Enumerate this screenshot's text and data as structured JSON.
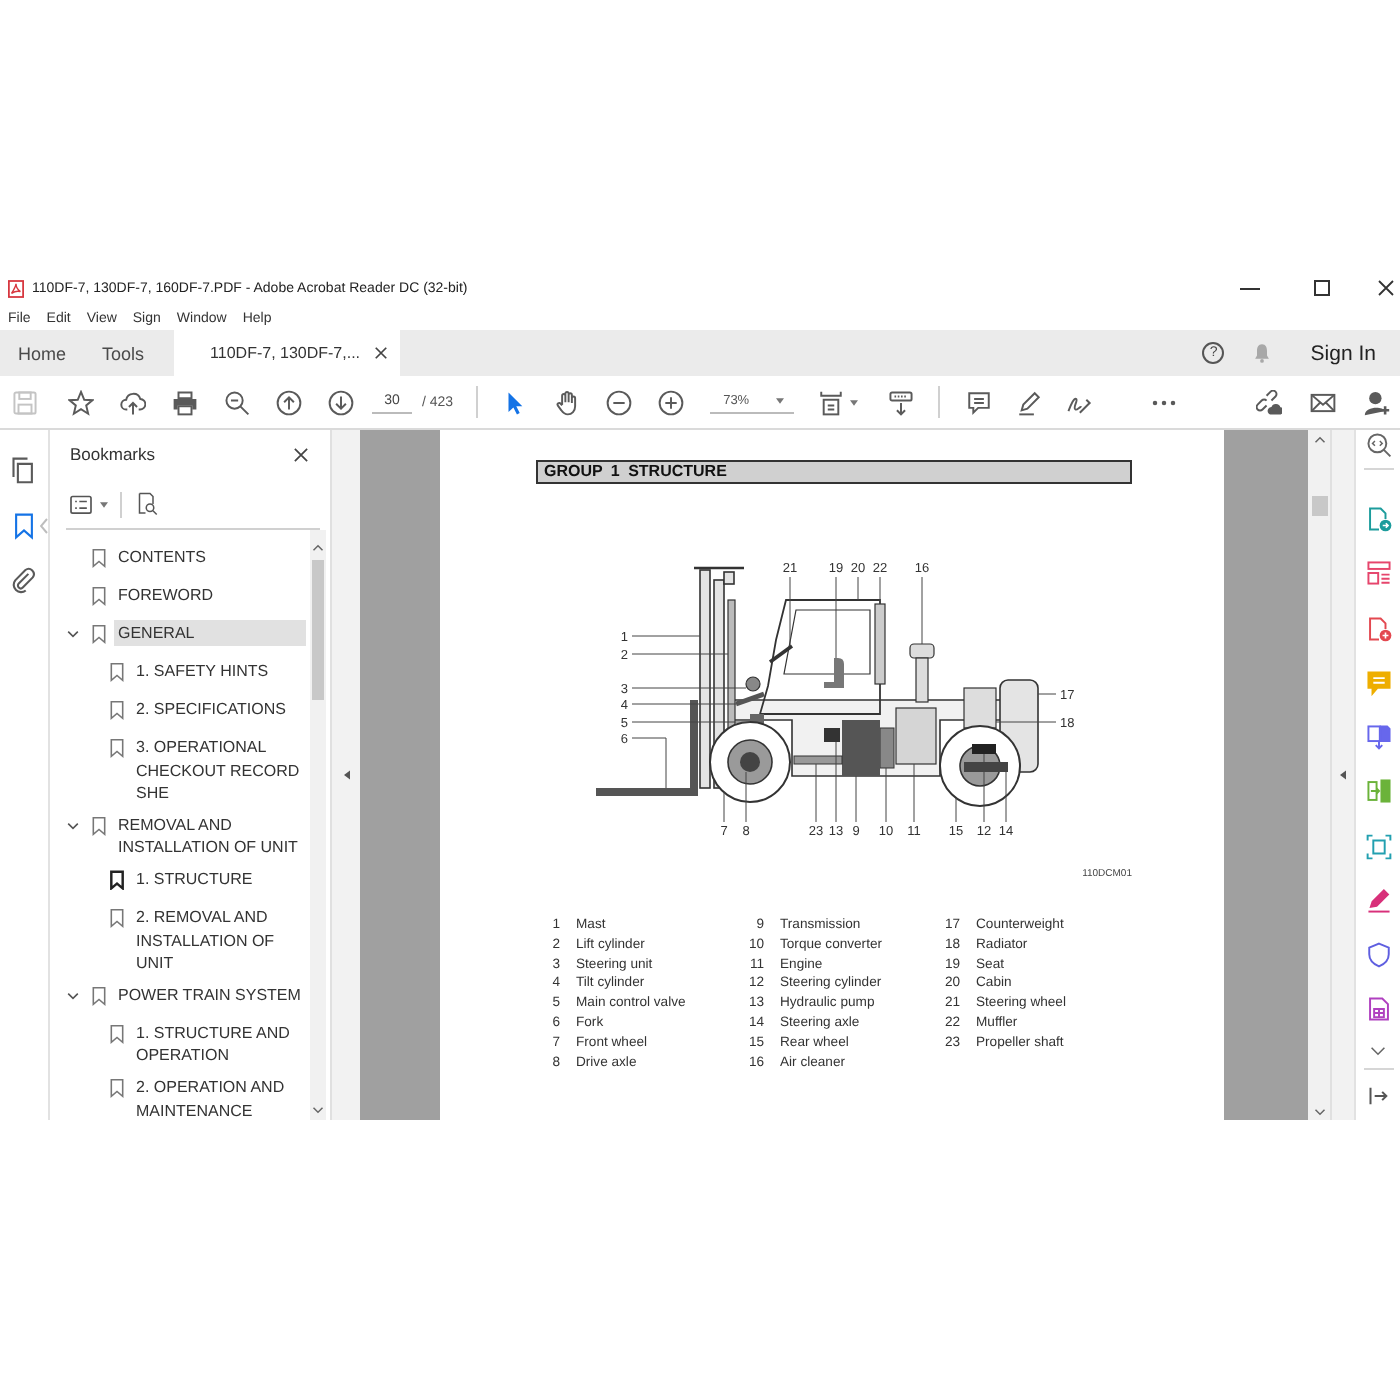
{
  "window": {
    "title": "110DF-7, 130DF-7, 160DF-7.PDF - Adobe Acrobat Reader DC (32-bit)"
  },
  "menu": [
    "File",
    "Edit",
    "View",
    "Sign",
    "Window",
    "Help"
  ],
  "tabs": [
    {
      "label": "Home",
      "selected": false,
      "closable": false
    },
    {
      "label": "Tools",
      "selected": false,
      "closable": false
    },
    {
      "label": "110DF-7, 130DF-7,...",
      "selected": true,
      "closable": true
    }
  ],
  "header_actions": {
    "help": "?",
    "sign_in": "Sign In"
  },
  "toolbar": {
    "save": {
      "disabled": true
    },
    "page": "30",
    "page_count": "/ 423",
    "tools": [
      {
        "kind": "select",
        "selected": true
      },
      {
        "kind": "hand",
        "selected": false
      }
    ],
    "zoom": "73%"
  },
  "left_rail": [
    {
      "kind": "pages",
      "selected": false
    },
    {
      "kind": "bookmarks",
      "selected": true
    },
    {
      "kind": "attachments",
      "selected": false
    }
  ],
  "bookmarks": {
    "title": "Bookmarks",
    "items": [
      {
        "label": "CONTENTS",
        "selected": false,
        "current": false
      },
      {
        "label": "FOREWORD",
        "selected": false,
        "current": false
      },
      {
        "label": "GENERAL",
        "selected": true,
        "current": false,
        "expanded": true,
        "children": [
          {
            "label": "1. SAFETY HINTS",
            "selected": false,
            "current": false
          },
          {
            "label": "2. SPECIFICATIONS",
            "selected": false,
            "current": false
          },
          {
            "label": "3. OPERATIONAL CHECKOUT RECORD SHE",
            "selected": false,
            "current": false
          }
        ]
      },
      {
        "label": "REMOVAL AND INSTALLATION OF UNIT",
        "selected": false,
        "current": false,
        "expanded": true,
        "children": [
          {
            "label": "1. STRUCTURE",
            "selected": false,
            "current": true
          },
          {
            "label": "2. REMOVAL AND INSTALLATION OF UNIT",
            "selected": false,
            "current": false
          }
        ]
      },
      {
        "label": "POWER TRAIN SYSTEM",
        "selected": false,
        "current": false,
        "expanded": true,
        "children": [
          {
            "label": "1. STRUCTURE AND OPERATION",
            "selected": false,
            "current": false
          },
          {
            "label": "2. OPERATION AND MAINTENANCE",
            "selected": false,
            "current": false
          }
        ]
      }
    ]
  },
  "page": {
    "heading": "GROUP 1 STRUCTURE",
    "figure": {
      "callouts": [
        "21",
        "19",
        "20",
        "22",
        "16",
        "1",
        "2",
        "3",
        "4",
        "5",
        "6",
        "17",
        "18",
        "7",
        "8",
        "23",
        "13",
        "9",
        "10",
        "11",
        "15",
        "12",
        "14"
      ],
      "code": "110DCM01"
    },
    "legend": [
      {
        "number": "1",
        "name": "Mast"
      },
      {
        "number": "2",
        "name": "Lift cylinder"
      },
      {
        "number": "3",
        "name": "Steering unit"
      },
      {
        "number": "4",
        "name": "Tilt cylinder"
      },
      {
        "number": "5",
        "name": "Main control valve"
      },
      {
        "number": "6",
        "name": "Fork"
      },
      {
        "number": "7",
        "name": "Front wheel"
      },
      {
        "number": "8",
        "name": "Drive axle"
      },
      {
        "number": "9",
        "name": "Transmission"
      },
      {
        "number": "10",
        "name": "Torque converter"
      },
      {
        "number": "11",
        "name": "Engine"
      },
      {
        "number": "12",
        "name": "Steering cylinder"
      },
      {
        "number": "13",
        "name": "Hydraulic pump"
      },
      {
        "number": "14",
        "name": "Steering axle"
      },
      {
        "number": "15",
        "name": "Rear wheel"
      },
      {
        "number": "16",
        "name": "Air cleaner"
      },
      {
        "number": "17",
        "name": "Counterweight"
      },
      {
        "number": "18",
        "name": "Radiator"
      },
      {
        "number": "19",
        "name": "Seat"
      },
      {
        "number": "20",
        "name": "Cabin"
      },
      {
        "number": "21",
        "name": "Steering wheel"
      },
      {
        "number": "22",
        "name": "Muffler"
      },
      {
        "number": "23",
        "name": "Propeller shaft"
      }
    ]
  }
}
